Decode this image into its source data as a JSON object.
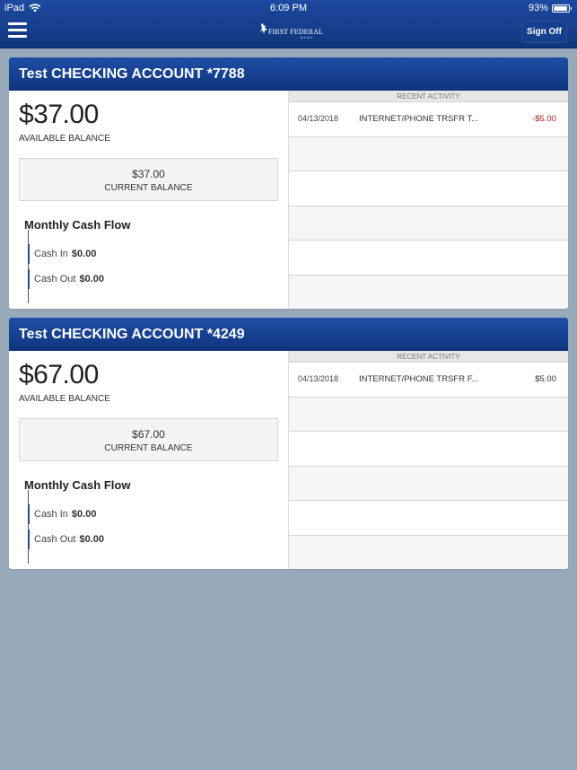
{
  "status_bar": {
    "device": "iPad",
    "time": "6:09 PM",
    "battery_percent": "93%",
    "battery_level": 0.93
  },
  "header": {
    "menu_icon": "hamburger-menu-icon",
    "logo_text": "FIRST FEDERAL",
    "logo_subtext": "BANK",
    "sign_off_label": "Sign Off"
  },
  "colors": {
    "brand_blue": "#163f8e",
    "background": "#98a9b9",
    "negative_amount": "#a61c1c",
    "positive_amount": "#333333",
    "cashflow_bar": "#2b4a85"
  },
  "accounts": [
    {
      "title": "Test CHECKING ACCOUNT *7788",
      "available_balance": "$37.00",
      "available_label": "AVAILABLE BALANCE",
      "current_balance": "$37.00",
      "current_label": "CURRENT BALANCE",
      "cash_flow": {
        "title": "Monthly Cash Flow",
        "cash_in_label": "Cash In",
        "cash_in_value": "$0.00",
        "cash_out_label": "Cash Out",
        "cash_out_value": "$0.00"
      },
      "recent_activity": {
        "header": "RECENT ACTIVITY",
        "rows": [
          {
            "date": "04/13/2018",
            "description": "INTERNET/PHONE TRSFR T...",
            "amount": "-$5.00",
            "negative": true
          },
          {
            "date": "",
            "description": "",
            "amount": ""
          },
          {
            "date": "",
            "description": "",
            "amount": ""
          },
          {
            "date": "",
            "description": "",
            "amount": ""
          },
          {
            "date": "",
            "description": "",
            "amount": ""
          },
          {
            "date": "",
            "description": "",
            "amount": ""
          }
        ]
      }
    },
    {
      "title": "Test CHECKING ACCOUNT *4249",
      "available_balance": "$67.00",
      "available_label": "AVAILABLE BALANCE",
      "current_balance": "$67.00",
      "current_label": "CURRENT BALANCE",
      "cash_flow": {
        "title": "Monthly Cash Flow",
        "cash_in_label": "Cash In",
        "cash_in_value": "$0.00",
        "cash_out_label": "Cash Out",
        "cash_out_value": "$0.00"
      },
      "recent_activity": {
        "header": "RECENT ACTIVITY",
        "rows": [
          {
            "date": "04/13/2018",
            "description": "INTERNET/PHONE TRSFR F...",
            "amount": "$5.00",
            "negative": false
          },
          {
            "date": "",
            "description": "",
            "amount": ""
          },
          {
            "date": "",
            "description": "",
            "amount": ""
          },
          {
            "date": "",
            "description": "",
            "amount": ""
          },
          {
            "date": "",
            "description": "",
            "amount": ""
          },
          {
            "date": "",
            "description": "",
            "amount": ""
          }
        ]
      }
    }
  ]
}
